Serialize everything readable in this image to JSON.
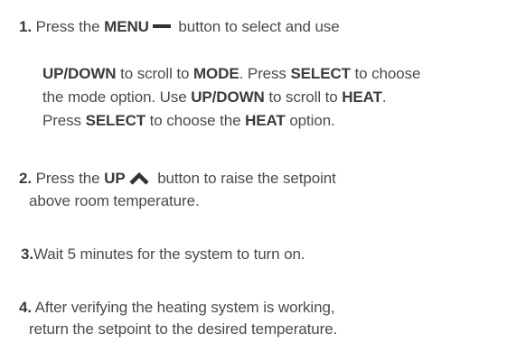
{
  "step1": {
    "number": "1.",
    "t1": "Press the ",
    "b1": "MENU",
    "icon": "menu-dash-icon",
    "t2": " button to select and use",
    "p1_b1": "UP/DOWN",
    "p1_t1": " to scroll to ",
    "p1_b2": "MODE",
    "p1_t2": ". Press ",
    "p1_b3": "SELECT",
    "p1_t3": " to choose",
    "p2_t1": "the mode option. Use ",
    "p2_b1": "UP/DOWN",
    "p2_t2": " to scroll to ",
    "p2_b2": "HEAT",
    "p2_t3": ".",
    "p3_t1": "Press ",
    "p3_b1": "SELECT",
    "p3_t2": " to choose the ",
    "p3_b2": "HEAT",
    "p3_t3": " option."
  },
  "step2": {
    "number": "2.",
    "t1": "Press the ",
    "b1": "UP",
    "icon": "chevron-up-icon",
    "t2": " button to raise the setpoint",
    "l2": "above room temperature."
  },
  "step3": {
    "number": "3.",
    "t1": "Wait 5 minutes for the system to turn on."
  },
  "step4": {
    "number": "4.",
    "t1": "After verifying the heating system is working,",
    "l2": "return the setpoint to the desired temperature."
  },
  "colors": {
    "text": "#4a4a4a",
    "bold": "#3b3b3b",
    "icon": "#333333"
  }
}
